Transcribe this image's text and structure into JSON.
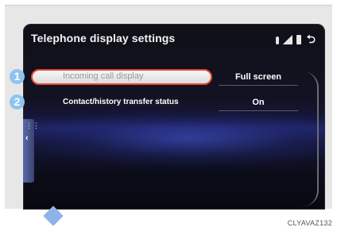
{
  "screen": {
    "title": "Telephone display settings",
    "status_icons": [
      "bluetooth-icon",
      "signal-icon",
      "battery-icon",
      "back-icon"
    ]
  },
  "settings": [
    {
      "number": "1",
      "label": "Incoming call display",
      "value": "Full screen",
      "selected": true
    },
    {
      "number": "2",
      "label": "Contact/history transfer status",
      "value": "On",
      "selected": false
    }
  ],
  "side_panel": {
    "icons": [
      "menu-icon",
      "chevron-left-icon"
    ]
  },
  "figure_code": "CLYAVAZ132",
  "colors": {
    "highlight_border": "#e8462e",
    "callout": "#8fc4f0",
    "screen_accent": "#1f2466"
  }
}
